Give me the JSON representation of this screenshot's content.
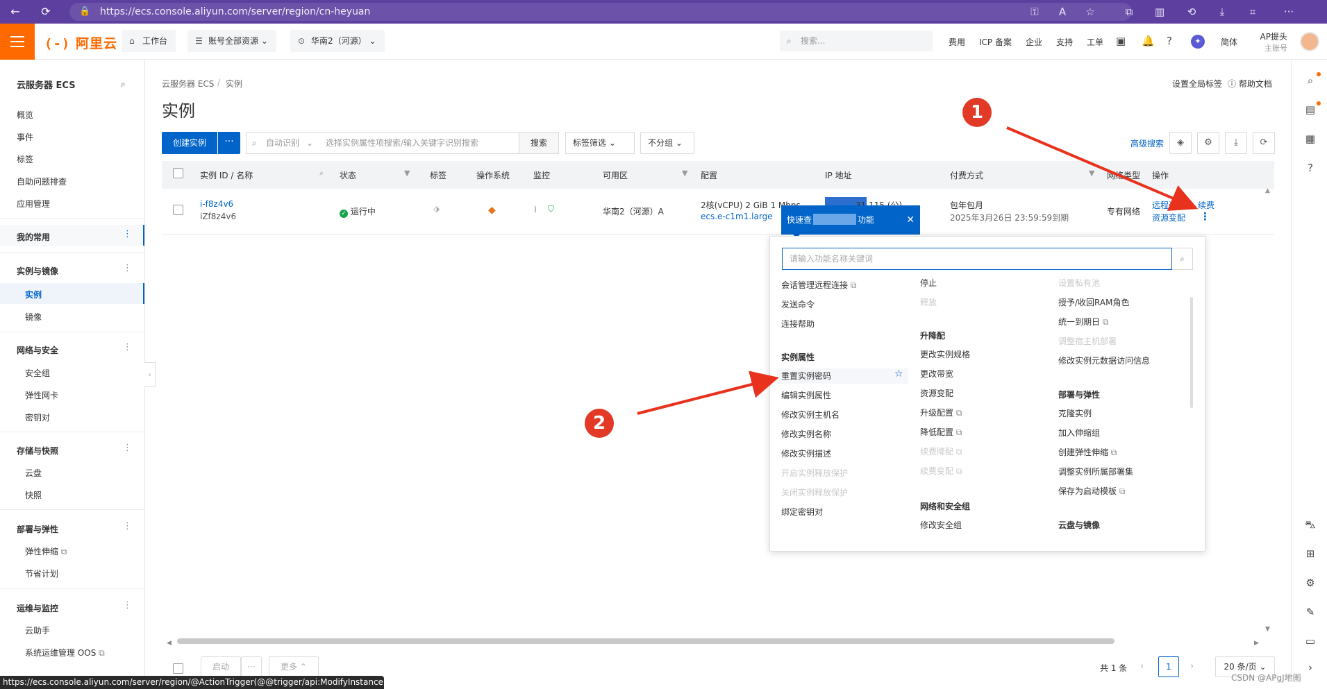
{
  "browser": {
    "url": "https://ecs.console.aliyun.com/server/region/cn-heyuan",
    "icons": [
      "back-icon",
      "refresh-icon",
      "lock-icon",
      "key-icon",
      "read-aloud-icon",
      "favorite-icon",
      "extensions-icon",
      "split-screen-icon",
      "history-icon",
      "download-icon",
      "screenshot-icon",
      "more-icon"
    ]
  },
  "header": {
    "logo": "阿里云",
    "workbench": "工作台",
    "resources": "账号全部资源",
    "region": "华南2（河源）",
    "search_placeholder": "搜索...",
    "links": [
      "费用",
      "ICP 备案",
      "企业",
      "支持",
      "工单"
    ],
    "lang": "简体",
    "account_name": "AP提头",
    "account_type": "主账号",
    "brand_color": "#ff6a00"
  },
  "sidebar": {
    "title": "云服务器 ECS",
    "top_items": [
      "概览",
      "事件",
      "标签",
      "自助问题排查",
      "应用管理"
    ],
    "mine": "我的常用",
    "groups": [
      {
        "label": "实例与镜像",
        "items": [
          "实例",
          "镜像"
        ]
      },
      {
        "label": "网络与安全",
        "items": [
          "安全组",
          "弹性网卡",
          "密钥对"
        ]
      },
      {
        "label": "存储与快照",
        "items": [
          "云盘",
          "快照"
        ]
      },
      {
        "label": "部署与弹性",
        "items": [
          "弹性伸缩",
          "节省计划"
        ]
      },
      {
        "label": "运维与监控",
        "items": [
          "云助手",
          "系统运维管理 OOS"
        ]
      }
    ]
  },
  "main": {
    "breadcrumb": [
      "云服务器 ECS",
      "/",
      "实例"
    ],
    "title": "实例",
    "top_links": [
      "设置全局标签",
      "帮助文档"
    ],
    "create_label": "创建实例",
    "more_label": "···",
    "auto_identify": "自动识别",
    "filter_placeholder": "选择实例属性项搜索/输入关键字识别搜索",
    "search_label": "搜索",
    "tag_filter": "标签筛选",
    "group": "不分组",
    "advanced": "高级搜索"
  },
  "table": {
    "columns": [
      "实例 ID / 名称",
      "状态",
      "标签",
      "操作系统",
      "监控",
      "可用区",
      "配置",
      "IP 地址",
      "付费方式",
      "网络类型",
      "操作"
    ],
    "row": {
      "id": "i-f8z4v6",
      "name": "iZf8z4v6",
      "status": "运行中",
      "zone": "华南2（河源）A",
      "config_line1": "2核(vCPU)  2 GiB 1 Mbps",
      "config_line2": "ecs.e-c1m1.large",
      "ip": "31.115 (公)",
      "billing": "包年包月",
      "expiry": "2025年3月26日 23:59:59到期",
      "network": "专有网络",
      "op_remote": "远程连接",
      "op_renew": "续费",
      "op_change": "资源变配"
    }
  },
  "quick": {
    "label_left": "快速查",
    "label_right": "功能",
    "close": "✕"
  },
  "menu": {
    "search_placeholder": "请输入功能名称关键词",
    "col1": {
      "items_top": [
        "会话管理远程连接",
        "发送命令",
        "连接帮助"
      ],
      "header": "实例属性",
      "items": [
        "重置实例密码",
        "编辑实例属性",
        "修改实例主机名",
        "修改实例名称",
        "修改实例描述",
        "开启实例释放保护",
        "关闭实例释放保护",
        "绑定密钥对"
      ]
    },
    "col2": {
      "items_top": [
        "停止",
        "释放"
      ],
      "header1": "升降配",
      "items1": [
        "更改实例规格",
        "更改带宽",
        "资源变配",
        "升级配置",
        "降低配置",
        "续费降配",
        "续费变配"
      ],
      "header2": "网络和安全组",
      "items2": [
        "修改安全组"
      ]
    },
    "col3": {
      "items_top": [
        "设置私有池",
        "授予/收回RAM角色",
        "统一到期日",
        "调整宿主机部署",
        "修改实例元数据访问信息"
      ],
      "header1": "部署与弹性",
      "items1": [
        "克隆实例",
        "加入伸缩组",
        "创建弹性伸缩",
        "调整实例所属部署集",
        "保存为启动模板"
      ],
      "header2": "云盘与镜像"
    }
  },
  "annotations": {
    "one": "1",
    "two": "2",
    "arrow_color": "#e8321e"
  },
  "bottom": {
    "start": "启动",
    "more": "更多",
    "total": "共 1 条",
    "page": "1",
    "per_page": "20 条/页",
    "status_url": "https://ecs.console.aliyun.com/server/region/@ActionTrigger(@@trigger/api:ModifyInstancePassword)",
    "watermark": "CSDN @APgJ地图"
  }
}
